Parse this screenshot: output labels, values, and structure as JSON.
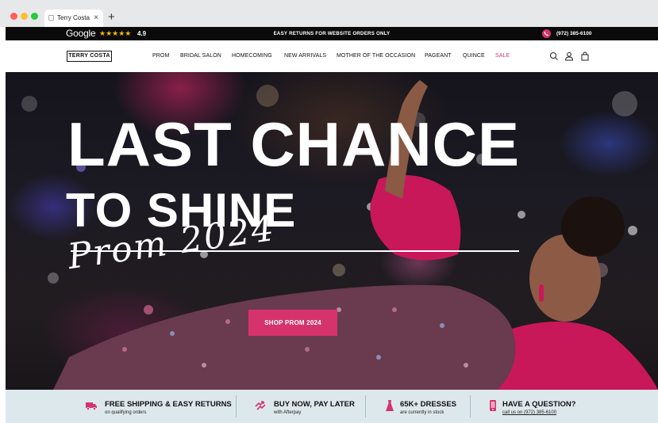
{
  "browser": {
    "tab_title": "Terry Costa",
    "tab_close": "×",
    "new_tab": "+"
  },
  "topbar": {
    "google_label": "Google",
    "stars": "★★★★★",
    "rating": "4.9",
    "promo": "EASY RETURNS FOR WEBSITE ORDERS ONLY",
    "phone": "(972) 385-6100"
  },
  "nav": {
    "logo": "TERRY COSTA",
    "items": [
      {
        "label": "PROM"
      },
      {
        "label": "BRIDAL SALON"
      },
      {
        "label": "HOMECOMING"
      },
      {
        "label": "NEW ARRIVALS"
      },
      {
        "label": "MOTHER OF THE OCCASION"
      },
      {
        "label": "PAGEANT"
      },
      {
        "label": "QUINCE"
      },
      {
        "label": "SALE"
      }
    ]
  },
  "hero": {
    "title_line1": "LAST CHANCE",
    "title_line2": "TO SHINE",
    "script": "Prom 2024",
    "cta": "SHOP PROM 2024"
  },
  "benefits": [
    {
      "title": "FREE SHIPPING & EASY RETURNS",
      "subtitle": "on qualifying orders",
      "icon": "truck-icon"
    },
    {
      "title": "BUY NOW, PAY LATER",
      "subtitle": "with Afterpay",
      "icon": "afterpay-icon"
    },
    {
      "title": "65K+ DRESSES",
      "subtitle": "are currently in stock",
      "icon": "dress-icon"
    },
    {
      "title": "HAVE A QUESTION?",
      "subtitle": "call us on (972) 385-6100",
      "icon": "phone-icon"
    }
  ],
  "colors": {
    "accent": "#d6336c",
    "benefit_bg": "#dde8ec",
    "topbar_bg": "#0a0a0a"
  }
}
